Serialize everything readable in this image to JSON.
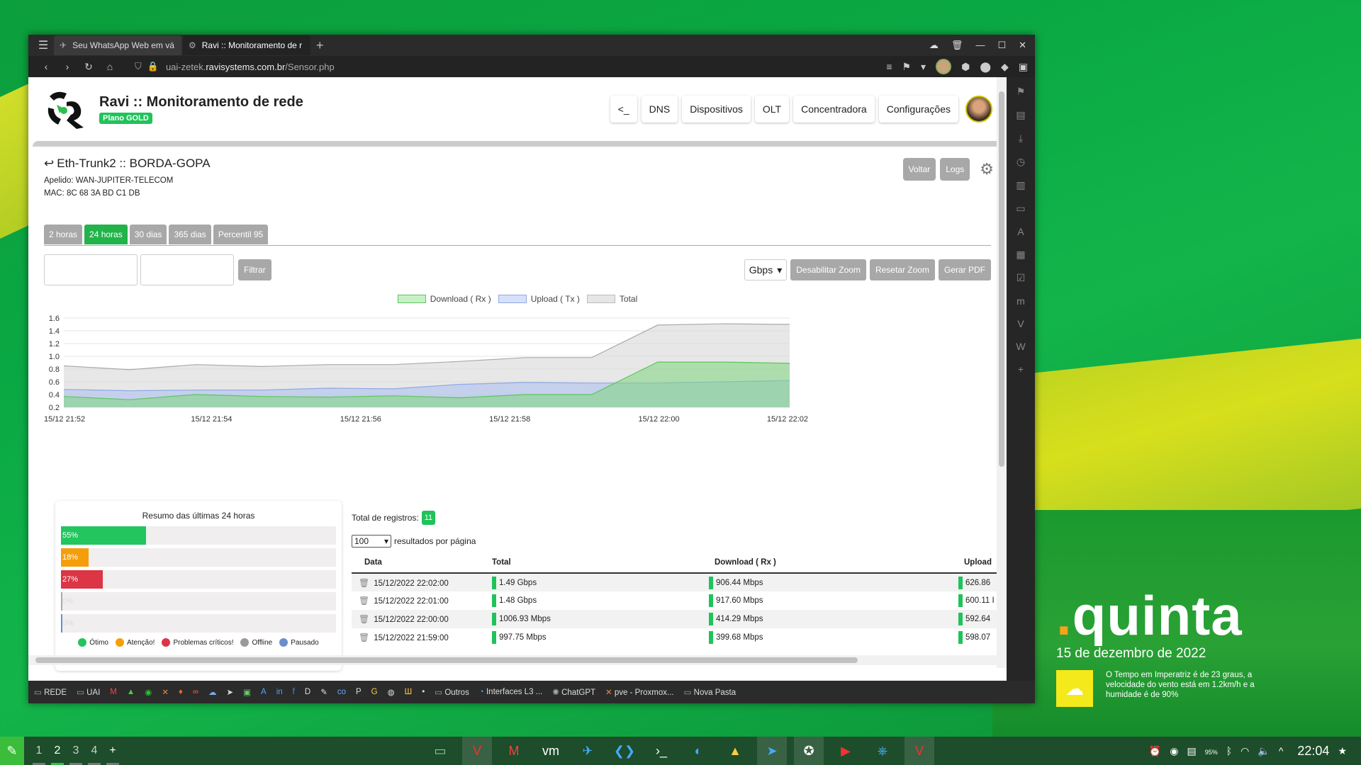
{
  "browser": {
    "tabs": [
      {
        "title": "Seu WhatsApp Web em vá",
        "active": false
      },
      {
        "title": "Ravi :: Monitoramento de r",
        "active": true
      }
    ],
    "url_path_prefix": "uai-zetek.",
    "url_host": "ravisystems.com.br",
    "url_path": "/Sensor.php"
  },
  "app": {
    "title": "Ravi :: Monitoramento de rede",
    "plan": "Plano GOLD",
    "nav": [
      "<_",
      "DNS",
      "Dispositivos",
      "OLT",
      "Concentradora",
      "Configurações"
    ]
  },
  "sensor": {
    "title": "Eth-Trunk2 :: BORDA-GOPA",
    "apelido": "Apelido: WAN-JUPITER-TELECOM",
    "mac": "MAC: 8C 68 3A BD C1 DB",
    "actions": {
      "back": "Voltar",
      "logs": "Logs"
    }
  },
  "range_tabs": [
    {
      "label": "2 horas",
      "active": false
    },
    {
      "label": "24 horas",
      "active": true
    },
    {
      "label": "30 dias",
      "active": false
    },
    {
      "label": "365 dias",
      "active": false
    },
    {
      "label": "Percentil 95",
      "active": false
    }
  ],
  "filter": {
    "button": "Filtrar",
    "unit": "Gbps",
    "disable_zoom": "Desabilitar Zoom",
    "reset_zoom": "Resetar Zoom",
    "pdf": "Gerar PDF"
  },
  "chart_data": {
    "type": "area",
    "x": [
      "15/12 21:52",
      "15/12 21:54",
      "15/12 21:56",
      "15/12 21:58",
      "15/12 22:00",
      "15/12 22:02"
    ],
    "series": [
      {
        "name": "Download ( Rx )",
        "color": "#7ed67e",
        "values": [
          0.37,
          0.32,
          0.4,
          0.37,
          0.36,
          0.38,
          0.35,
          0.4,
          0.4,
          0.91,
          0.91,
          0.89
        ]
      },
      {
        "name": "Upload ( Tx )",
        "color": "#8fa8e6",
        "values": [
          0.48,
          0.46,
          0.47,
          0.47,
          0.5,
          0.49,
          0.56,
          0.59,
          0.58,
          0.58,
          0.6,
          0.62
        ]
      },
      {
        "name": "Total",
        "color": "#bbbbbb",
        "values": [
          0.85,
          0.79,
          0.87,
          0.84,
          0.87,
          0.87,
          0.92,
          0.98,
          0.98,
          1.49,
          1.51,
          1.5
        ]
      }
    ],
    "ylim": [
      0.2,
      1.6
    ],
    "yticks": [
      "1.6",
      "1.4",
      "1.2",
      "1.0",
      "0.8",
      "0.6",
      "0.4",
      "0.2"
    ],
    "grid": true,
    "legend": "top"
  },
  "summary": {
    "title": "Resumo das últimas 24 horas",
    "bars": [
      {
        "label": "55%",
        "value": 55,
        "color": "#22c55e"
      },
      {
        "label": "18%",
        "value": 18,
        "color": "#f59e0b"
      },
      {
        "label": "27%",
        "value": 27,
        "color": "#dc3545"
      },
      {
        "label": "0%",
        "value": 0,
        "color": "#aaaaaa"
      },
      {
        "label": "0%",
        "value": 0,
        "color": "#6b8ec9"
      }
    ],
    "legend": [
      {
        "label": "Ótimo",
        "color": "#22c55e"
      },
      {
        "label": "Atenção!",
        "color": "#f59e0b"
      },
      {
        "label": "Problemas críticos!",
        "color": "#dc3545"
      },
      {
        "label": "Offline",
        "color": "#999999"
      },
      {
        "label": "Pausado",
        "color": "#6b8ec9"
      }
    ]
  },
  "table": {
    "total_label": "Total de registros:",
    "total_count": "11",
    "per_page": "100",
    "per_page_label": "resultados por página",
    "headers": [
      "Data",
      "Total",
      "Download ( Rx )",
      "Upload"
    ],
    "rows": [
      {
        "date": "15/12/2022 22:02:00",
        "total": "1.49 Gbps",
        "download": "906.44 Mbps",
        "upload": "626.86"
      },
      {
        "date": "15/12/2022 22:01:00",
        "total": "1.48 Gbps",
        "download": "917.60 Mbps",
        "upload": "600.11 I"
      },
      {
        "date": "15/12/2022 22:00:00",
        "total": "1006.93 Mbps",
        "download": "414.29 Mbps",
        "upload": "592.64"
      },
      {
        "date": "15/12/2022 21:59:00",
        "total": "997.75 Mbps",
        "download": "399.68 Mbps",
        "upload": "598.07"
      }
    ]
  },
  "bookmarks": [
    "REDE",
    "UAI",
    "Outros",
    "Interfaces L3 ...",
    "ChatGPT",
    "pve - Proxmox...",
    "Nova Pasta"
  ],
  "desktop": {
    "day": "quinta",
    "date": "15 de dezembro de 2022",
    "weather": "O Tempo em Imperatriz é de 23 graus, a velocidade do vento está em 1.2km/h e a humidade é de 90%"
  },
  "taskbar": {
    "workspaces": [
      "1",
      "2",
      "3",
      "4",
      "+"
    ],
    "clock": "22:04",
    "battery": "95%"
  }
}
